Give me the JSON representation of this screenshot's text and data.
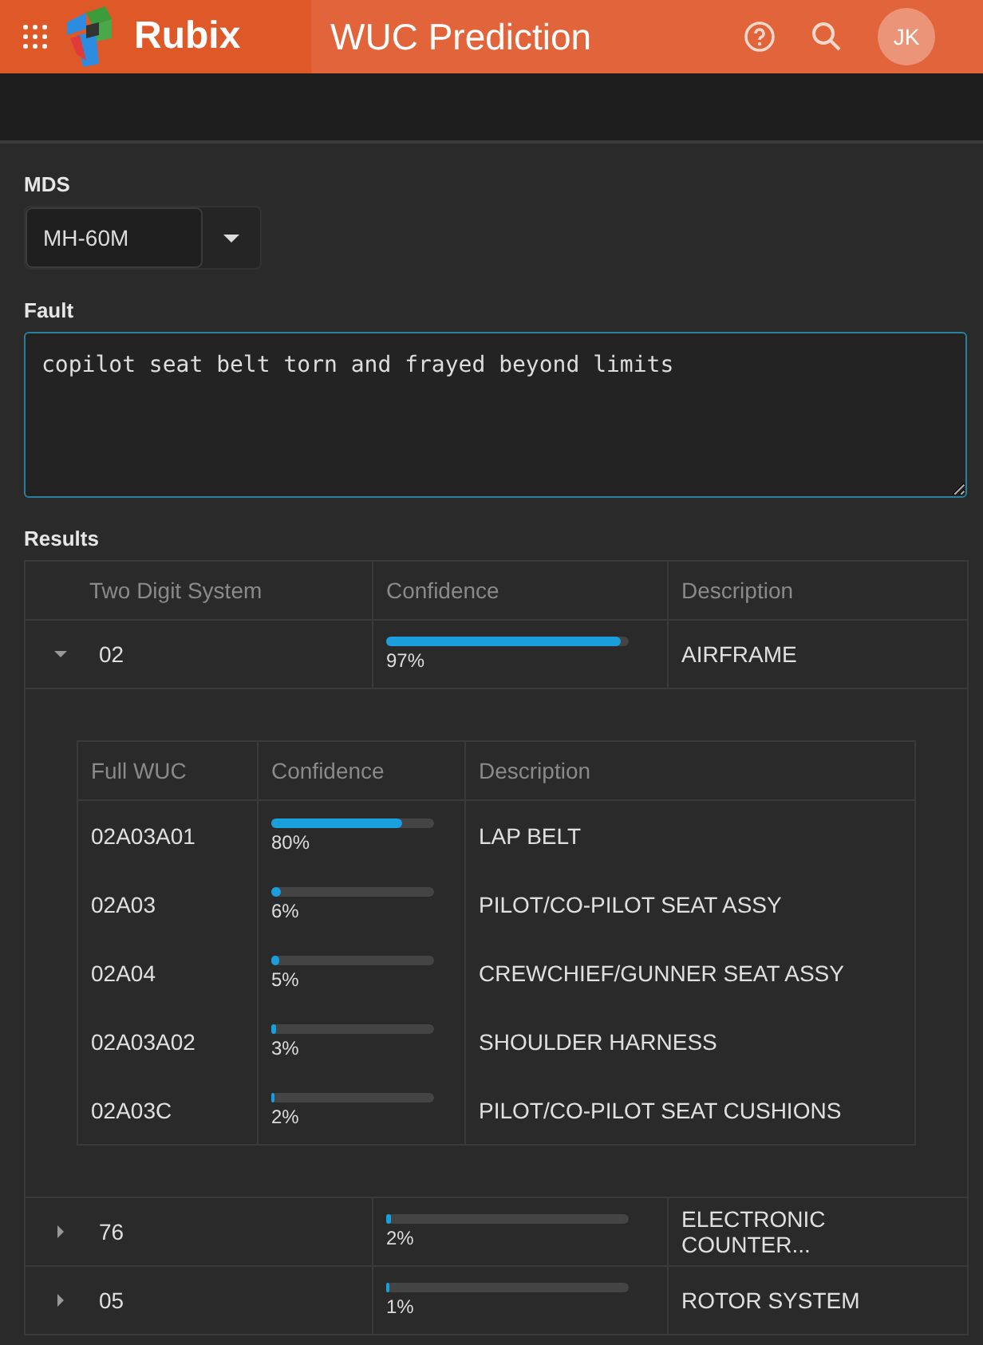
{
  "header": {
    "brand": "Rubix",
    "title": "WUC Prediction",
    "avatar": "JK"
  },
  "mds": {
    "label": "MDS",
    "value": "MH-60M"
  },
  "fault": {
    "label": "Fault",
    "value": "copilot seat belt torn and frayed beyond limits"
  },
  "results": {
    "label": "Results",
    "columns": [
      "Two Digit System",
      "Confidence",
      "Description"
    ],
    "rows": [
      {
        "system": "02",
        "level": 0.97,
        "reading": "97%",
        "description": "AIRFRAME",
        "expanded": true,
        "detail": {
          "columns": [
            "Full WUC",
            "Confidence",
            "Description"
          ],
          "rows": [
            {
              "wuc": "02A03A01",
              "level": 0.8,
              "reading": "80%",
              "description": "LAP BELT"
            },
            {
              "wuc": "02A03",
              "level": 0.06,
              "reading": "6%",
              "description": "PILOT/CO-PILOT SEAT ASSY"
            },
            {
              "wuc": "02A04",
              "level": 0.05,
              "reading": "5%",
              "description": "CREWCHIEF/GUNNER SEAT ASSY"
            },
            {
              "wuc": "02A03A02",
              "level": 0.03,
              "reading": "3%",
              "description": "SHOULDER HARNESS"
            },
            {
              "wuc": "02A03C",
              "level": 0.02,
              "reading": "2%",
              "description": "PILOT/CO-PILOT SEAT CUSHIONS"
            }
          ]
        }
      },
      {
        "system": "76",
        "level": 0.02,
        "reading": "2%",
        "description": "ELECTRONIC COUNTER...",
        "expanded": false
      },
      {
        "system": "05",
        "level": 0.01,
        "reading": "1%",
        "description": "ROTOR SYSTEM",
        "expanded": false
      }
    ]
  }
}
